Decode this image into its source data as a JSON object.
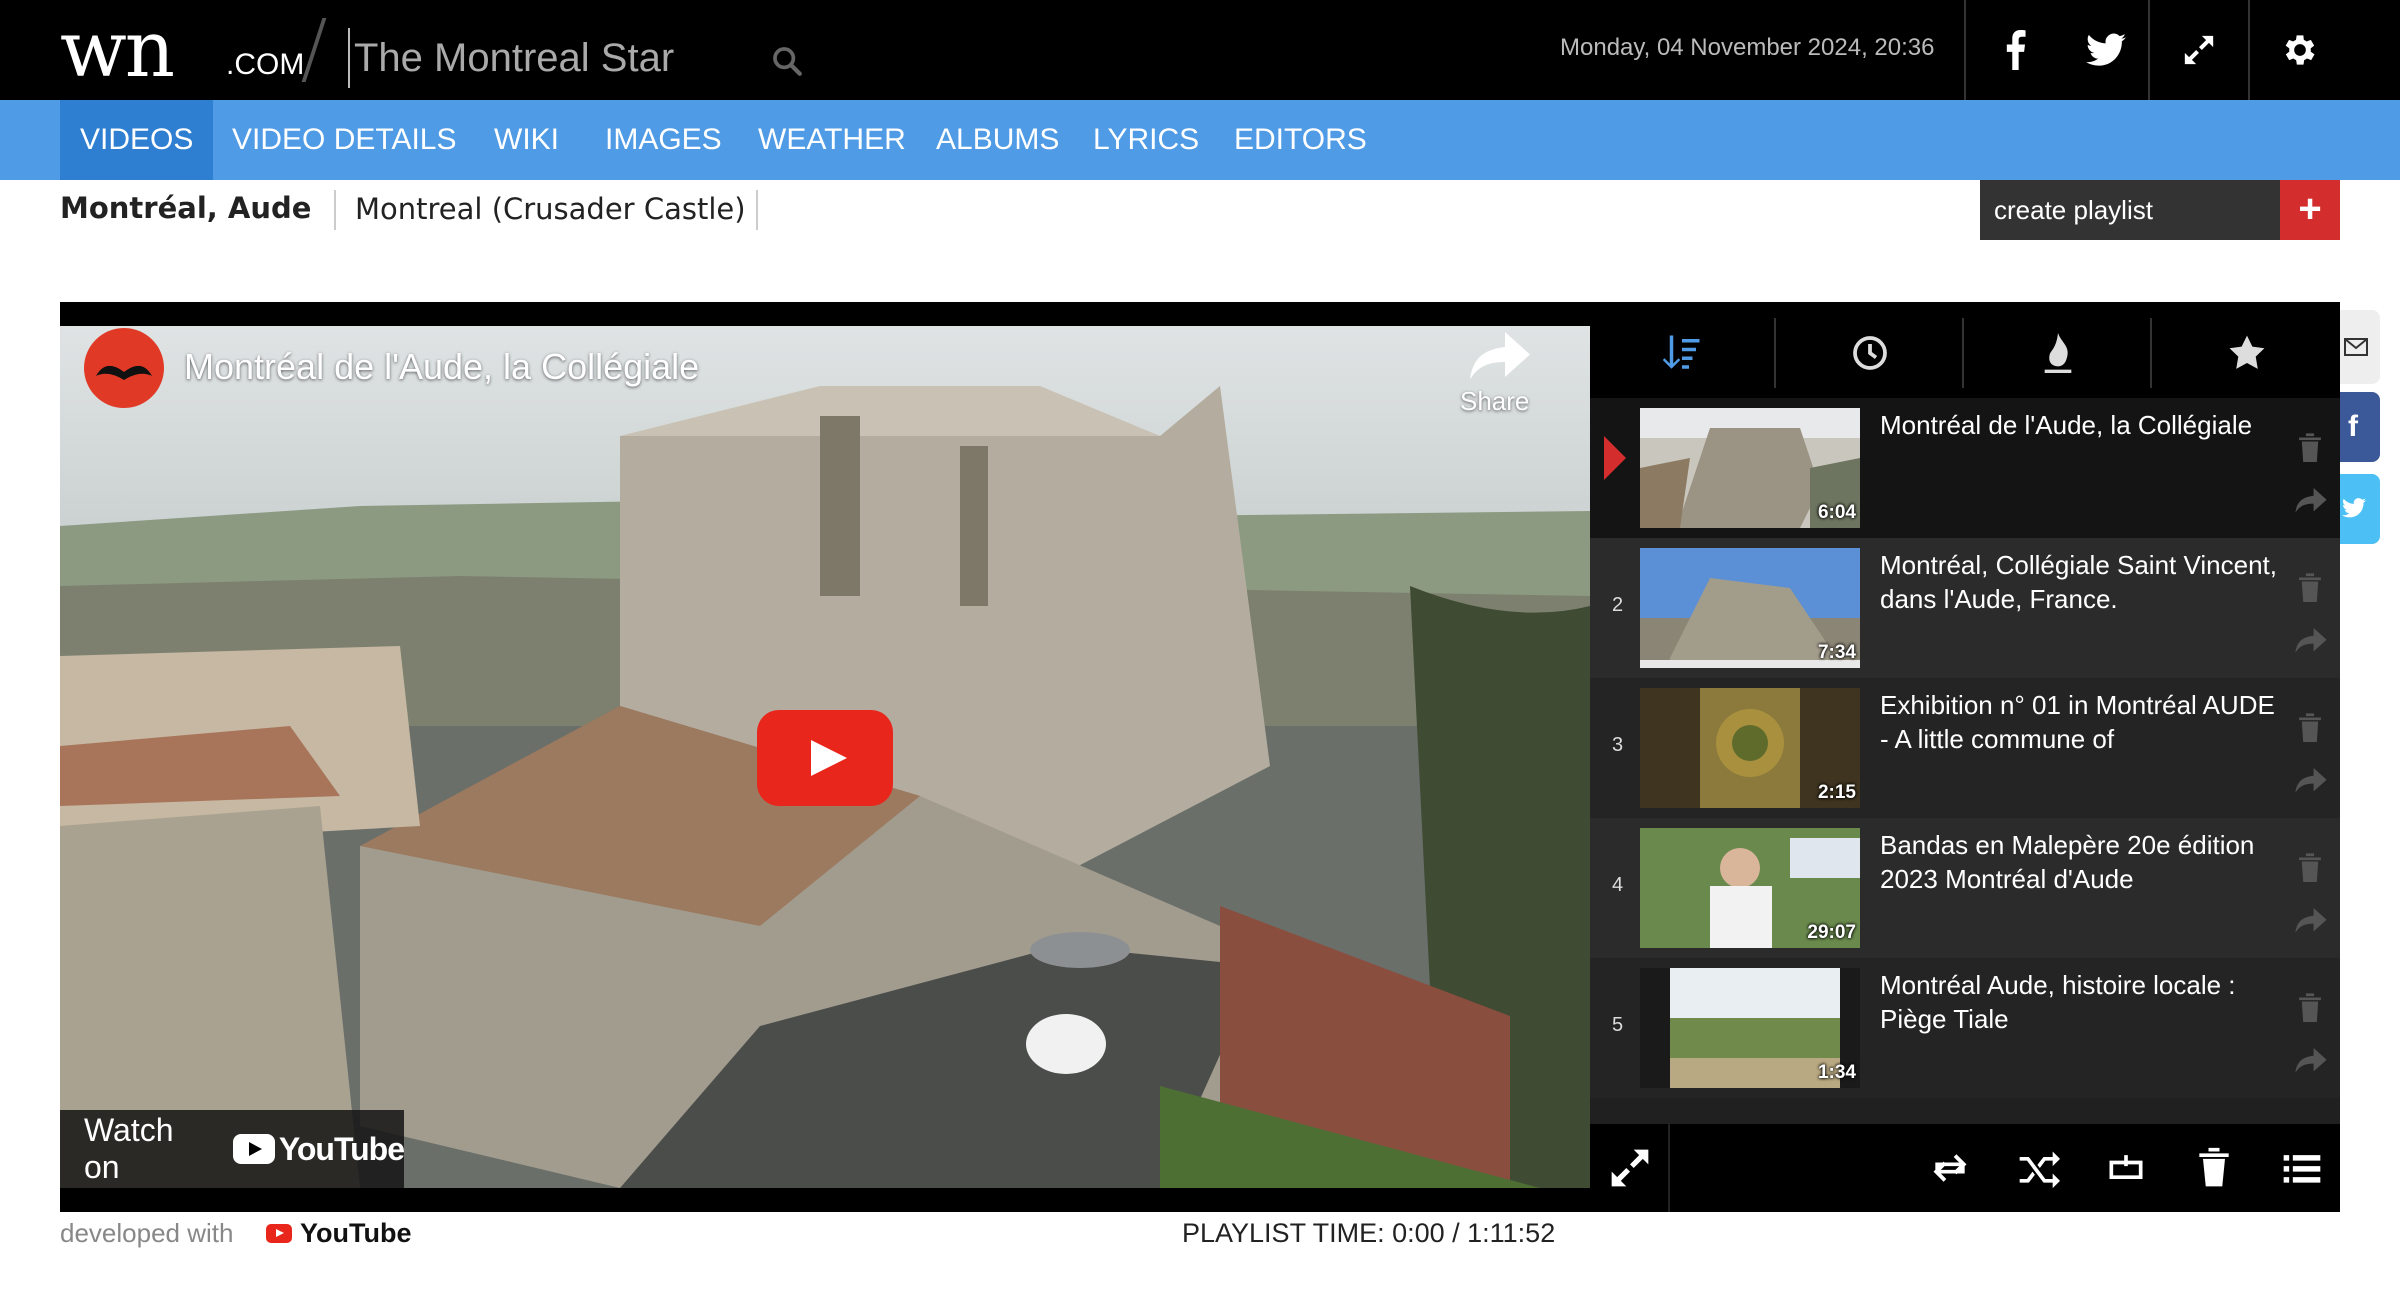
{
  "header": {
    "logo_main": "wn",
    "logo_com": ".COM",
    "site_name": "The Montreal Star",
    "datetime": "Monday, 04 November 2024, 20:36"
  },
  "nav": {
    "items": [
      "VIDEOS",
      "VIDEO DETAILS",
      "WIKI",
      "IMAGES",
      "WEATHER",
      "ALBUMS",
      "LYRICS",
      "EDITORS"
    ],
    "active": "VIDEOS"
  },
  "breadcrumb": {
    "primary": "Montréal, Aude",
    "secondary": "Montreal (Crusader Castle)"
  },
  "create_playlist": {
    "label": "create playlist",
    "plus": "+"
  },
  "video": {
    "title": "Montréal de l'Aude, la Collégiale",
    "share_label": "Share",
    "watch_on": "Watch on",
    "youtube": "YouTube"
  },
  "playlist": {
    "items": [
      {
        "num": "",
        "title": "Montréal de l'Aude, la Collégiale",
        "duration": "6:04",
        "current": true
      },
      {
        "num": "2",
        "title": "Montréal, Collégiale Saint Vincent, dans l'Aude, France.",
        "duration": "7:34",
        "current": false
      },
      {
        "num": "3",
        "title": "Exhibition n° 01 in Montréal AUDE - A little commune of",
        "duration": "2:15",
        "current": false
      },
      {
        "num": "4",
        "title": "Bandas en Malepère 20e édition 2023 Montréal d'Aude",
        "duration": "29:07",
        "current": false
      },
      {
        "num": "5",
        "title": "Montréal Aude, histoire locale : Piège Tiale",
        "duration": "1:34",
        "current": false
      }
    ]
  },
  "footer": {
    "developed_with": "developed with",
    "youtube": "YouTube",
    "playlist_time": "PLAYLIST TIME: 0:00 / 1:11:52"
  },
  "side_social": {
    "facebook_glyph": "f"
  },
  "colors": {
    "nav_blue": "#4f9be6",
    "nav_active": "#2e7fd1",
    "accent_red": "#d32d2d",
    "topbar": "#000000"
  }
}
